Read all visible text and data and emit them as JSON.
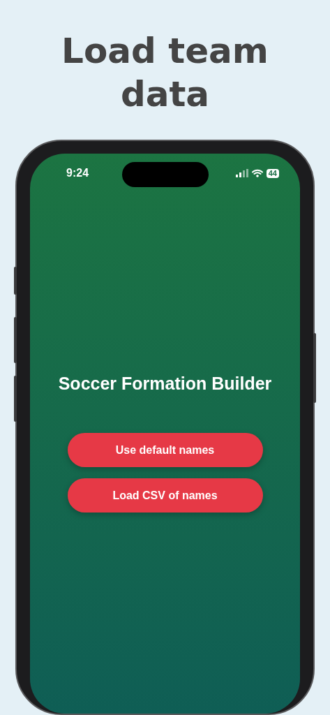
{
  "headline": "Load team data",
  "status_bar": {
    "time": "9:24",
    "battery": "44"
  },
  "app": {
    "title": "Soccer Formation Builder",
    "buttons": [
      {
        "label": "Use default names"
      },
      {
        "label": "Load CSV of names"
      }
    ]
  }
}
